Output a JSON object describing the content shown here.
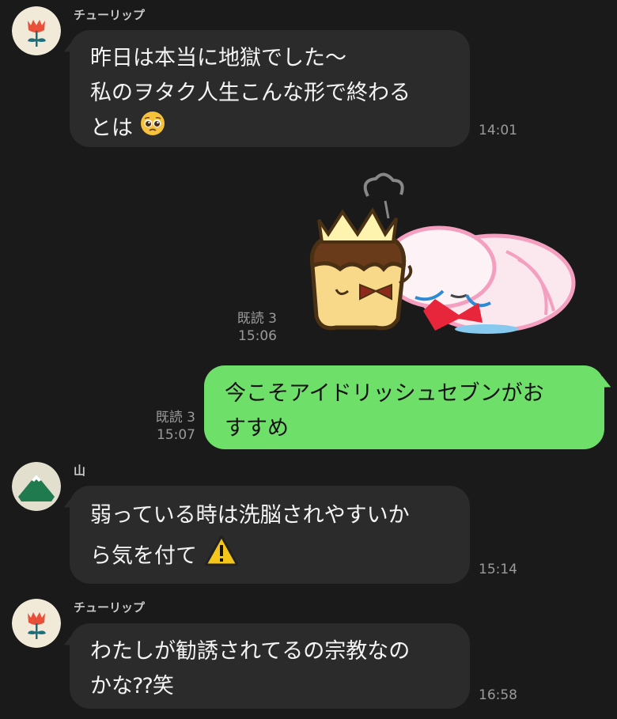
{
  "messages": [
    {
      "sender": "チューリップ",
      "lines": [
        "昨日は本当に地獄でした〜",
        "私のヲタク人生こんな形で終わる",
        "とは"
      ],
      "emoji": "pleading-face-emoji",
      "time": "14:01"
    },
    {
      "type": "sticker",
      "read": "既読 3",
      "time": "15:06"
    },
    {
      "sender_self": true,
      "lines": [
        "今こそアイドリッシュセブンがお",
        "すすめ"
      ],
      "read": "既読 3",
      "time": "15:07"
    },
    {
      "sender": "山",
      "lines": [
        "弱っている時は洗脳されやすいか",
        "ら気を付て"
      ],
      "emoji": "warning-sign-emoji",
      "time": "15:14"
    },
    {
      "sender": "チューリップ",
      "lines": [
        "わたしが勧誘されてるの宗教なの",
        "かな⁇笑"
      ],
      "time": "16:58"
    }
  ],
  "colors": {
    "background": "#1a1a1a",
    "incoming_bubble": "#2b2b2b",
    "outgoing_bubble": "#6ee06a"
  }
}
